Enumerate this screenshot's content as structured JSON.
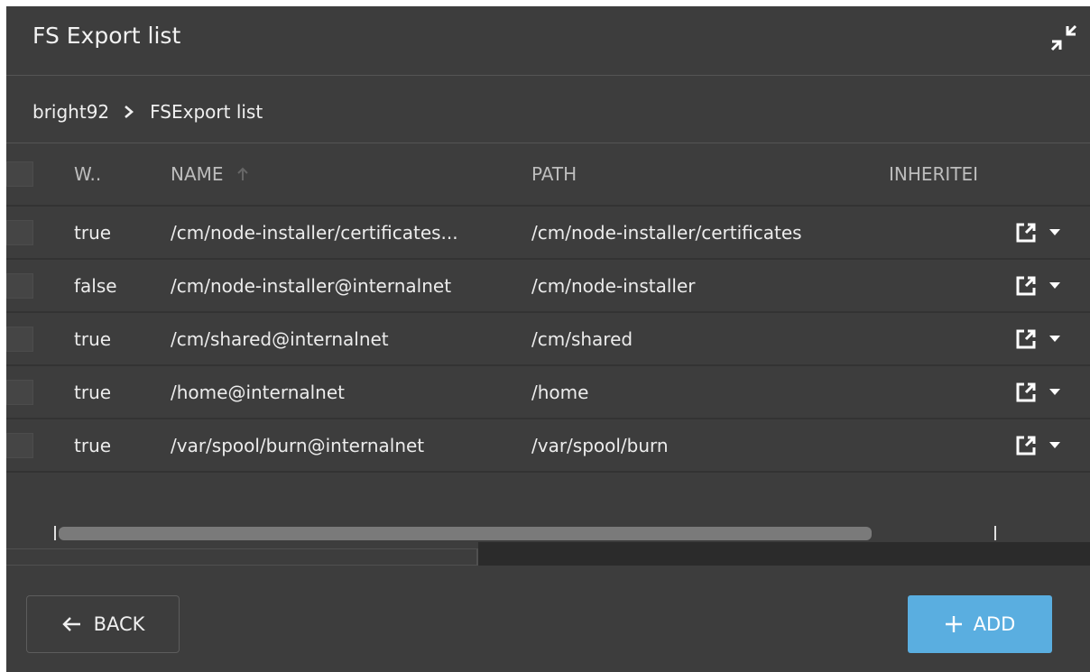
{
  "header": {
    "title": "FS Export list",
    "collapse_icon": "collapse-arrows-icon"
  },
  "breadcrumb": {
    "items": [
      "bright92",
      "FSExport list"
    ]
  },
  "table": {
    "columns": {
      "w": "W..",
      "name": "NAME",
      "path": "PATH",
      "inherited": "INHERITEI"
    },
    "rows": [
      {
        "w": "true",
        "name": "/cm/node-installer/certificates...",
        "path": "/cm/node-installer/certificates",
        "inherited": ""
      },
      {
        "w": "false",
        "name": "/cm/node-installer@internalnet",
        "path": "/cm/node-installer",
        "inherited": ""
      },
      {
        "w": "true",
        "name": "/cm/shared@internalnet",
        "path": "/cm/shared",
        "inherited": ""
      },
      {
        "w": "true",
        "name": "/home@internalnet",
        "path": "/home",
        "inherited": ""
      },
      {
        "w": "true",
        "name": "/var/spool/burn@internalnet",
        "path": "/var/spool/burn",
        "inherited": ""
      }
    ]
  },
  "footer": {
    "back_label": "BACK",
    "add_label": "ADD"
  },
  "colors": {
    "panel_bg": "#3d3d3d",
    "accent": "#5aaee0",
    "text": "#ececec"
  }
}
